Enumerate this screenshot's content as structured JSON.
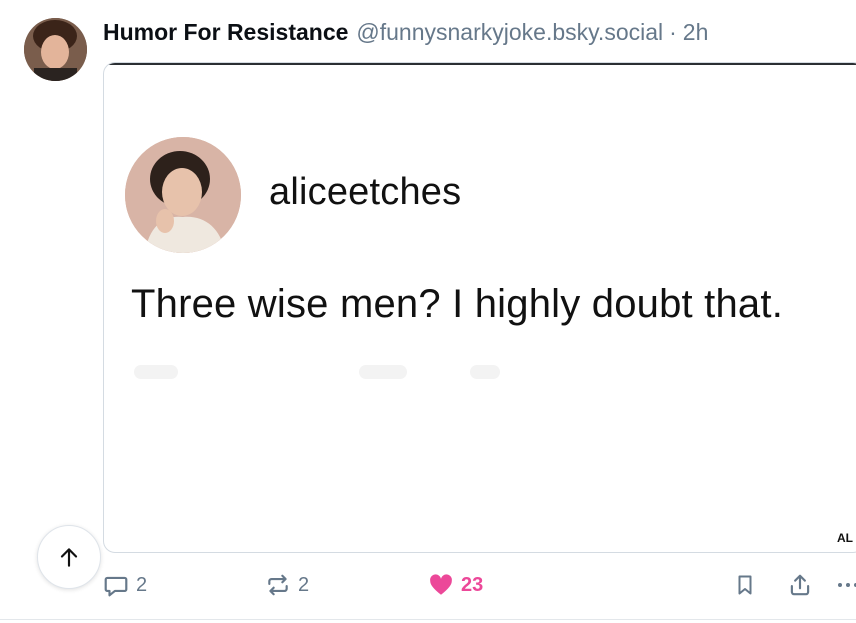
{
  "post": {
    "author_name": "Humor For Resistance",
    "author_handle": "@funnysnarkyjoke.bsky.social",
    "separator": "·",
    "time": "2h"
  },
  "embed": {
    "username": "aliceetches",
    "text": "Three wise men? I highly doubt that.",
    "alt_badge": "AL"
  },
  "actions": {
    "replies": "2",
    "reposts": "2",
    "likes": "23",
    "liked": true
  },
  "colors": {
    "like_pink": "#ec4899",
    "muted": "#66788a",
    "border": "#d4dbe2"
  },
  "icons": [
    "arrow-up-icon",
    "reply-icon",
    "repost-icon",
    "heart-icon",
    "bookmark-icon",
    "share-icon",
    "more-icon"
  ]
}
